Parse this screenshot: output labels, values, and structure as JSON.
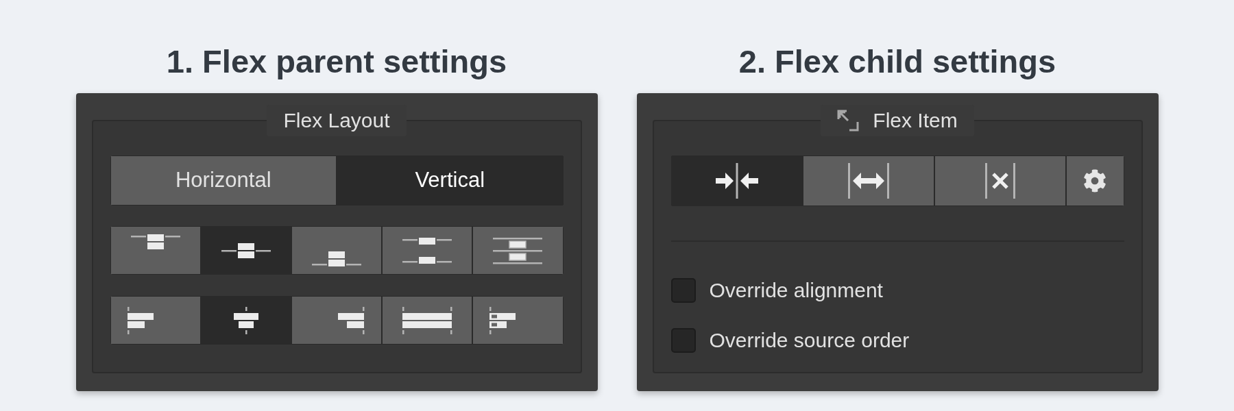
{
  "parent": {
    "heading": "1. Flex parent settings",
    "title": "Flex Layout",
    "direction_tabs": [
      {
        "label": "Horizontal",
        "selected": false
      },
      {
        "label": "Vertical",
        "selected": true
      }
    ],
    "justify_buttons": [
      {
        "kind": "start",
        "selected": false
      },
      {
        "kind": "center",
        "selected": true
      },
      {
        "kind": "end",
        "selected": false
      },
      {
        "kind": "between",
        "selected": false
      },
      {
        "kind": "around",
        "selected": false
      }
    ],
    "align_buttons": [
      {
        "kind": "start",
        "selected": false
      },
      {
        "kind": "center",
        "selected": true
      },
      {
        "kind": "end",
        "selected": false
      },
      {
        "kind": "stretch",
        "selected": false
      },
      {
        "kind": "baseline",
        "selected": false
      }
    ]
  },
  "child": {
    "heading": "2. Flex child settings",
    "title": "Flex Item",
    "sizing_buttons": [
      {
        "kind": "shrink",
        "selected": true
      },
      {
        "kind": "grow",
        "selected": false
      },
      {
        "kind": "none",
        "selected": false
      },
      {
        "kind": "custom",
        "selected": false
      }
    ],
    "checkboxes": [
      {
        "label": "Override alignment",
        "checked": false
      },
      {
        "label": "Override source order",
        "checked": false
      }
    ]
  }
}
